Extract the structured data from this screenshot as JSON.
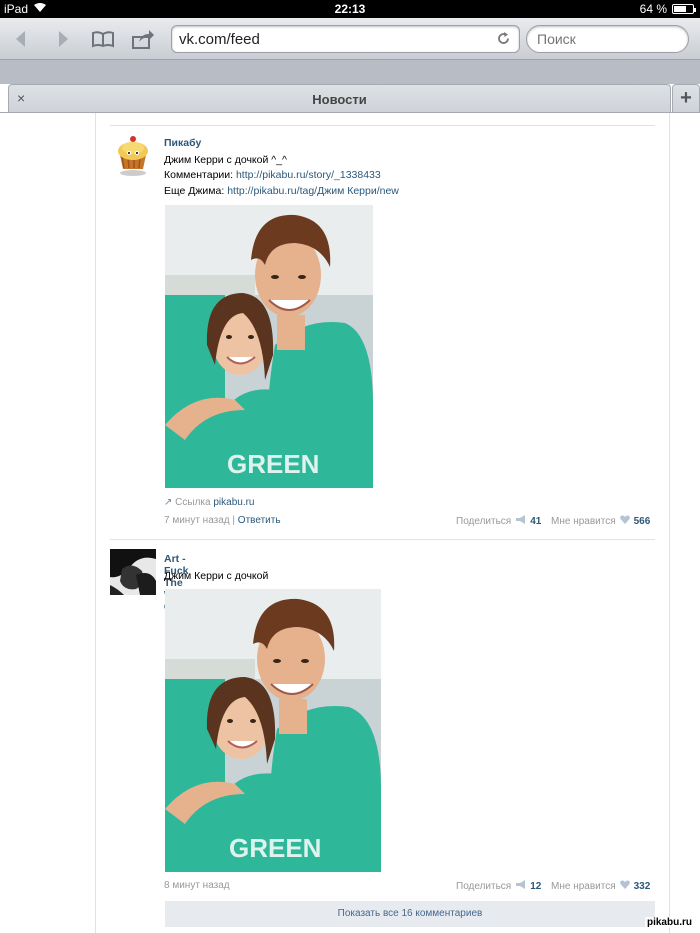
{
  "status": {
    "device": "iPad",
    "time": "22:13",
    "battery": "64 %",
    "battery_level": 0.64
  },
  "browser": {
    "url": "vk.com/feed",
    "search_placeholder": "Поиск",
    "tab_title": "Новости",
    "close_glyph": "×",
    "newtab_glyph": "+"
  },
  "posts": [
    {
      "author": "Пикабу",
      "lines": [
        {
          "text": "Джим Керри с дочкой ^_^",
          "link": ""
        },
        {
          "text": "Комментарии: ",
          "link": "http://pikabu.ru/story/_1338433"
        },
        {
          "text": "Еще Джима: ",
          "link": "http://pikabu.ru/tag/Джим Керри/new"
        }
      ],
      "source_label": "Ссылка",
      "source_link": "pikabu.ru",
      "time": "7 минут назад",
      "reply": "Ответить",
      "share_label": "Поделиться",
      "share_count": "41",
      "like_label": "Мне нравится",
      "like_count": "566",
      "photo_text": "GREEN"
    },
    {
      "author": "Art - Fuck The World ©",
      "lines": [
        {
          "text": "Джим Керри с дочкой",
          "link": ""
        }
      ],
      "time": "8 минут назад",
      "share_label": "Поделиться",
      "share_count": "12",
      "like_label": "Мне нравится",
      "like_count": "332",
      "photo_text": "GREEN"
    }
  ],
  "comments_button": "Показать все 16 комментариев",
  "watermark": "pikabu.ru",
  "colors": {
    "link": "#2b587a",
    "meta": "#999999",
    "accent_button": "#e7ebf0",
    "shirt": "#2fb79a"
  }
}
